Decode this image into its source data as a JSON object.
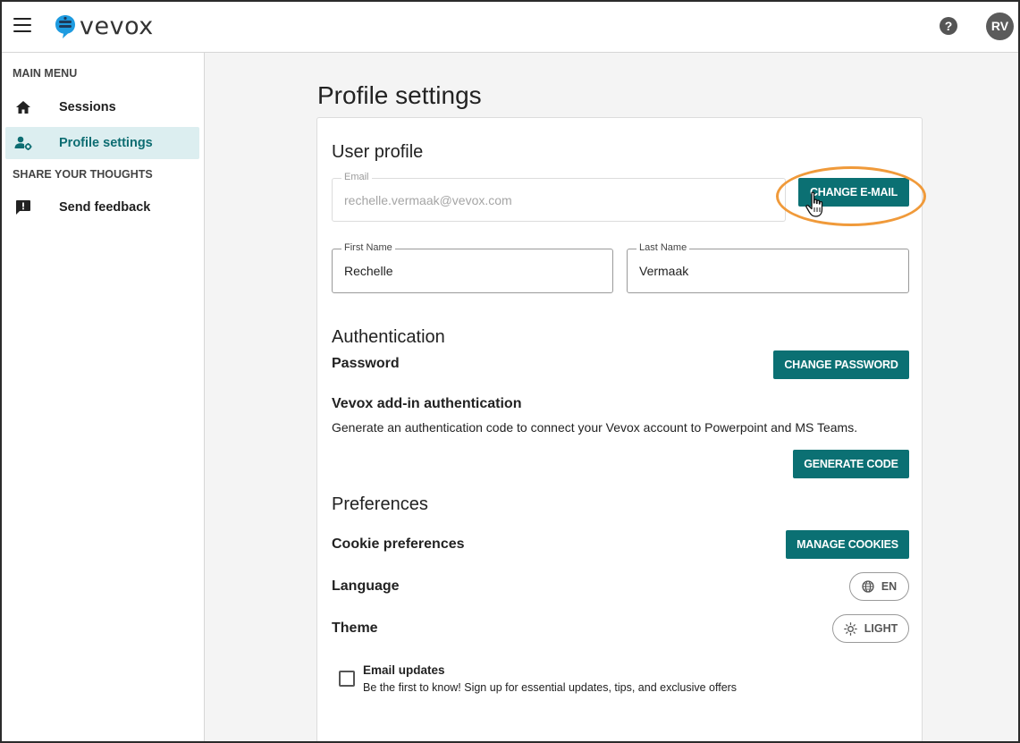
{
  "topbar": {
    "logo_text": "vevox",
    "help_label": "?",
    "avatar_initials": "RV"
  },
  "sidebar": {
    "main_menu_label": "MAIN MENU",
    "share_label": "SHARE YOUR THOUGHTS",
    "items": [
      {
        "label": "Sessions",
        "icon": "home-icon",
        "active": false
      },
      {
        "label": "Profile settings",
        "icon": "user-settings-icon",
        "active": true
      },
      {
        "label": "Send feedback",
        "icon": "feedback-icon",
        "active": false
      }
    ]
  },
  "page": {
    "title": "Profile settings"
  },
  "user_profile": {
    "heading": "User profile",
    "email_label": "Email",
    "email_value": "rechelle.vermaak@vevox.com",
    "change_email_button": "CHANGE E-MAIL",
    "first_name_label": "First Name",
    "first_name_value": "Rechelle",
    "last_name_label": "Last Name",
    "last_name_value": "Vermaak"
  },
  "authentication": {
    "heading": "Authentication",
    "password_label": "Password",
    "change_password_button": "CHANGE PASSWORD",
    "addin_heading": "Vevox add-in authentication",
    "addin_description": "Generate an authentication code to connect your Vevox account to Powerpoint and MS Teams.",
    "generate_code_button": "GENERATE CODE"
  },
  "preferences": {
    "heading": "Preferences",
    "cookie_label": "Cookie preferences",
    "manage_cookies_button": "MANAGE COOKIES",
    "language_label": "Language",
    "language_value": "EN",
    "theme_label": "Theme",
    "theme_value": "LIGHT",
    "email_updates_title": "Email updates",
    "email_updates_desc": "Be the first to know! Sign up for essential updates, tips, and exclusive offers",
    "email_updates_checked": false
  },
  "colors": {
    "accent": "#0b7073",
    "active_bg": "#dceef0",
    "highlight": "#f09a3a",
    "logo_blue": "#1e9be0"
  }
}
